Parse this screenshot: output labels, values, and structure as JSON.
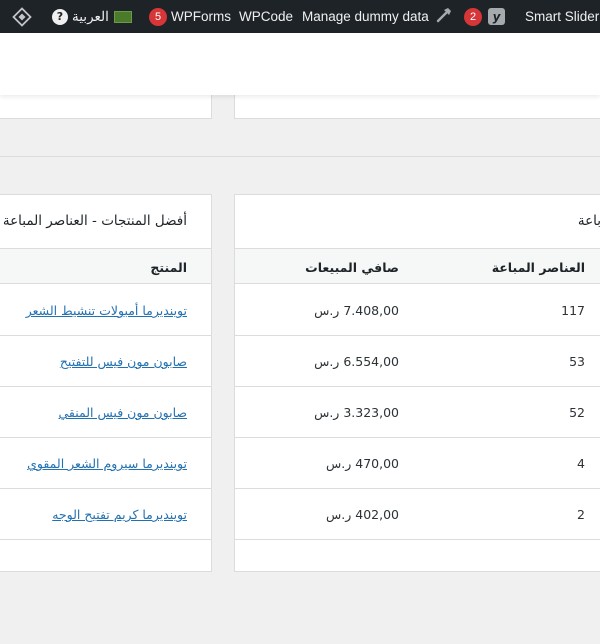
{
  "admin_bar": {
    "language": "العربية",
    "wpforms_count": "5",
    "wpforms_label": "WPForms",
    "wpcode_label": "WPCode",
    "dummy_label": "Manage dummy data",
    "yoast_count": "2",
    "smart_slider_label": "Smart Slider"
  },
  "left_panel": {
    "title": "أفضل المنتجات - العناصر المباعة",
    "col_product": "المنتج",
    "products": [
      "توينديرما أمبولات تنشيط الشعر",
      "صابون مون فيس للتفتيح",
      "صابون مون فيس المنقي",
      "توينديرما سيروم الشعر المقوي",
      "توينديرما كريم تفتيح الوجه"
    ]
  },
  "right_panel": {
    "title_fragment": "باعة",
    "col_items_sold": "العناصر المباعة",
    "col_net_sales": "صافي المبيعات",
    "rows": [
      {
        "items": "117",
        "net": "7.408,00 ر.س"
      },
      {
        "items": "53",
        "net": "6.554,00 ر.س"
      },
      {
        "items": "52",
        "net": "3.323,00 ر.س"
      },
      {
        "items": "4",
        "net": "470,00 ر.س"
      },
      {
        "items": "2",
        "net": "402,00 ر.س"
      }
    ]
  },
  "colors": {
    "admin_bar_bg": "#1d2327",
    "link": "#2271b1",
    "badge": "#d63638"
  }
}
